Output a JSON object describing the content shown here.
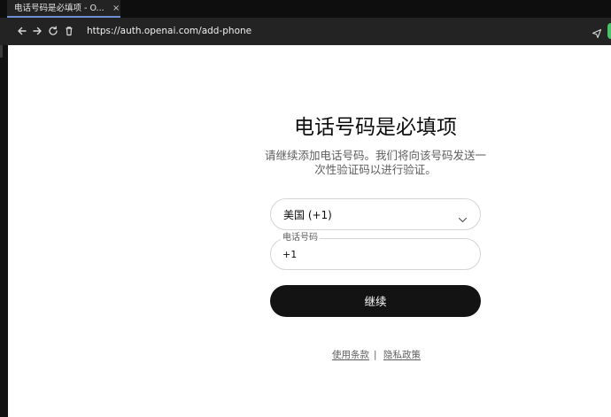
{
  "browser": {
    "tab_title": "电话号码是必填项 - O...",
    "tab_close": "×",
    "url": "https://auth.openai.com/add-phone"
  },
  "page": {
    "title": "电话号码是必填项",
    "subtitle": "请继续添加电话号码。我们将向该号码发送一次性验证码以进行验证。",
    "country_select": {
      "selected": "美国 (+1)"
    },
    "phone": {
      "label": "电话号码",
      "value": "+1"
    },
    "continue_label": "继续",
    "footer": {
      "terms": "使用条款",
      "separator": "|",
      "privacy": "隐私政策"
    }
  },
  "colors": {
    "button_bg": "#131313",
    "chrome_bg": "#232323",
    "tab_accent": "#6e8fd6"
  },
  "icons": [
    "back-icon",
    "forward-icon",
    "reload-icon",
    "trash-icon",
    "send-icon",
    "chevron-down-icon"
  ]
}
